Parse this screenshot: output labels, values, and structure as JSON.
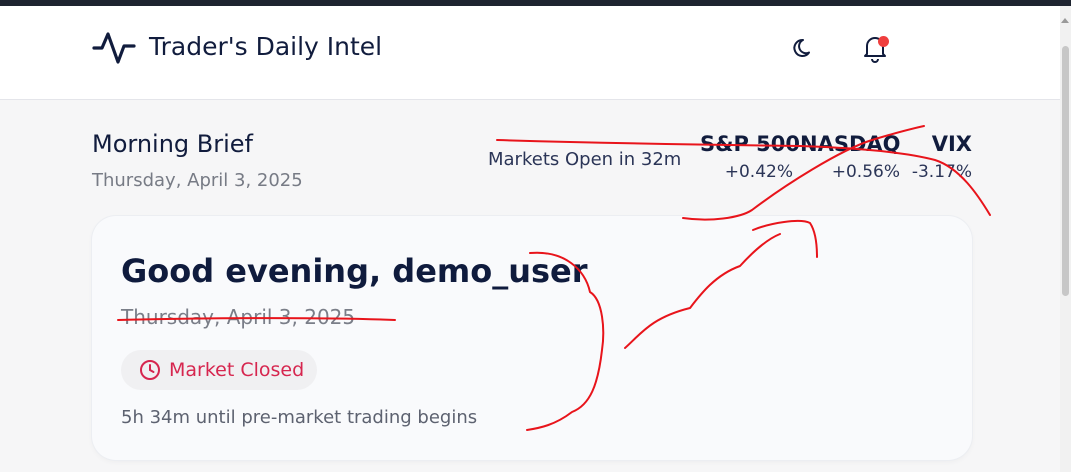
{
  "app": {
    "title": "Trader's Daily Intel"
  },
  "header": {
    "logo_icon": "activity-pulse-icon",
    "theme_icon": "moon-icon",
    "notification_icon": "bell-icon",
    "notification_dot_color": "#ef3e3e"
  },
  "brief": {
    "title": "Morning Brief",
    "date": "Thursday, April 3, 2025",
    "market_open_text": "Markets Open in 32m"
  },
  "indices": [
    {
      "name": "S&P 500",
      "change": "+0.42%"
    },
    {
      "name": "NASDAQ",
      "change": "+0.56%"
    },
    {
      "name": "VIX",
      "change": "-3.17%"
    }
  ],
  "greeting": {
    "text": "Good evening, demo_user",
    "date": "Thursday, April 3, 2025",
    "status_label": "Market Closed",
    "status_icon": "clock-icon",
    "status_color": "#d6264f",
    "countdown": "5h 34m until pre-market trading begins"
  },
  "annotation_color": "#e8141b"
}
